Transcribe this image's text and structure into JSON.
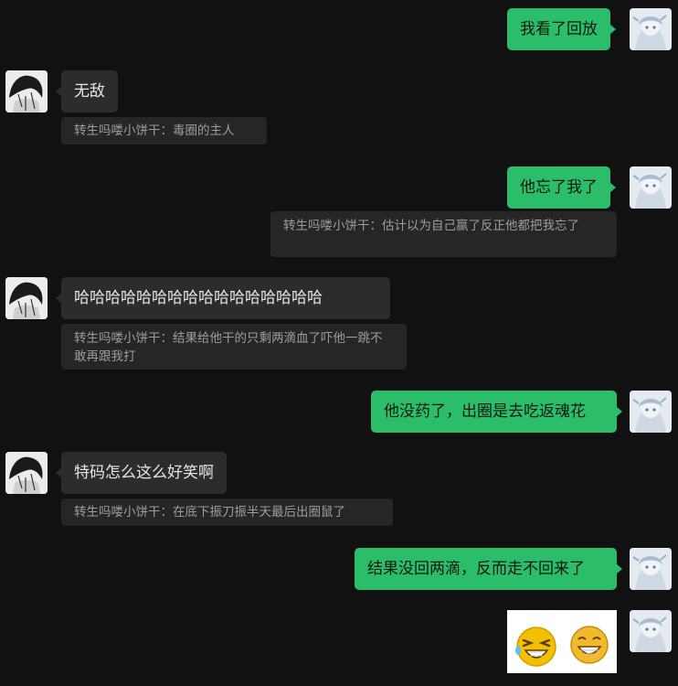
{
  "messages": [
    {
      "sender": "self",
      "text": "我看了回放"
    },
    {
      "sender": "other",
      "text": "无敌",
      "quote": "转生吗喽小饼干：毒圈的主人"
    },
    {
      "sender": "self",
      "text": "他忘了我了",
      "quote": "转生吗喽小饼干：估计以为自己赢了反正他都把我忘了"
    },
    {
      "sender": "other",
      "text": "哈哈哈哈哈哈哈哈哈哈哈哈哈哈哈哈",
      "quote": "转生吗喽小饼干：结果给他干的只剩两滴血了吓他一跳不敢再跟我打"
    },
    {
      "sender": "self",
      "text": "他没药了，出圈是去吃返魂花"
    },
    {
      "sender": "other",
      "text": "特码怎么这么好笑啊",
      "quote": "转生吗喽小饼干：在底下振刀振半天最后出圈鼠了"
    },
    {
      "sender": "self",
      "text": "结果没回两滴，反而走不回来了"
    },
    {
      "sender": "self",
      "sticker": "laughing-emoji-pair-sticker"
    }
  ],
  "colors": {
    "background": "#111111",
    "self_bubble": "#2bbd69",
    "other_bubble": "#2c2c2c",
    "quote_bg": "#262626",
    "quote_text": "#9c9c9c"
  }
}
